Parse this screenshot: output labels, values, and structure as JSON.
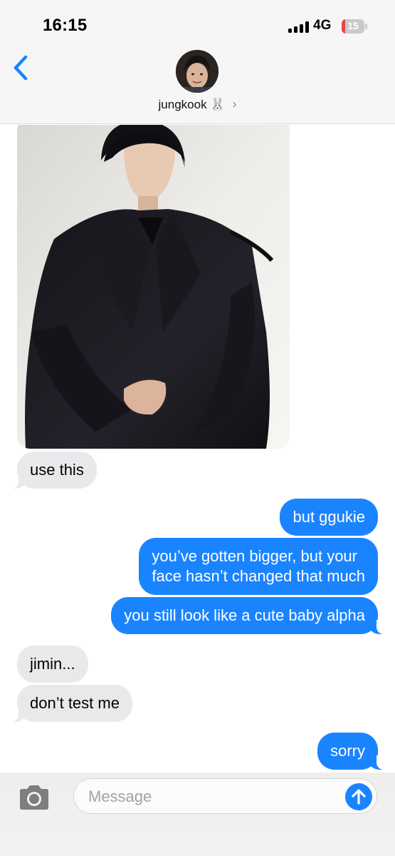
{
  "status_bar": {
    "time": "16:15",
    "network": "4G",
    "battery_level": "15",
    "battery_fraction": 0.15
  },
  "header": {
    "contact_name": "jungkook 🐰",
    "chevron": "›"
  },
  "conversation": {
    "photo_description_icon": "photo-attachment",
    "messages": [
      {
        "direction": "incoming",
        "text": "use this"
      },
      {
        "direction": "outgoing",
        "text": "but ggukie"
      },
      {
        "direction": "outgoing",
        "line1": "you’ve gotten bigger, but your",
        "line2": "face hasn’t changed that much"
      },
      {
        "direction": "outgoing",
        "text": "you still look like a cute baby alpha"
      },
      {
        "direction": "incoming",
        "text": "jimin..."
      },
      {
        "direction": "incoming",
        "text": "don’t test me"
      },
      {
        "direction": "outgoing",
        "text": "sorry"
      }
    ]
  },
  "composer": {
    "placeholder": "Message"
  },
  "colors": {
    "outgoing_bubble": "#1a84ff",
    "incoming_bubble": "#e9e9eb",
    "accent": "#1a84ff"
  }
}
